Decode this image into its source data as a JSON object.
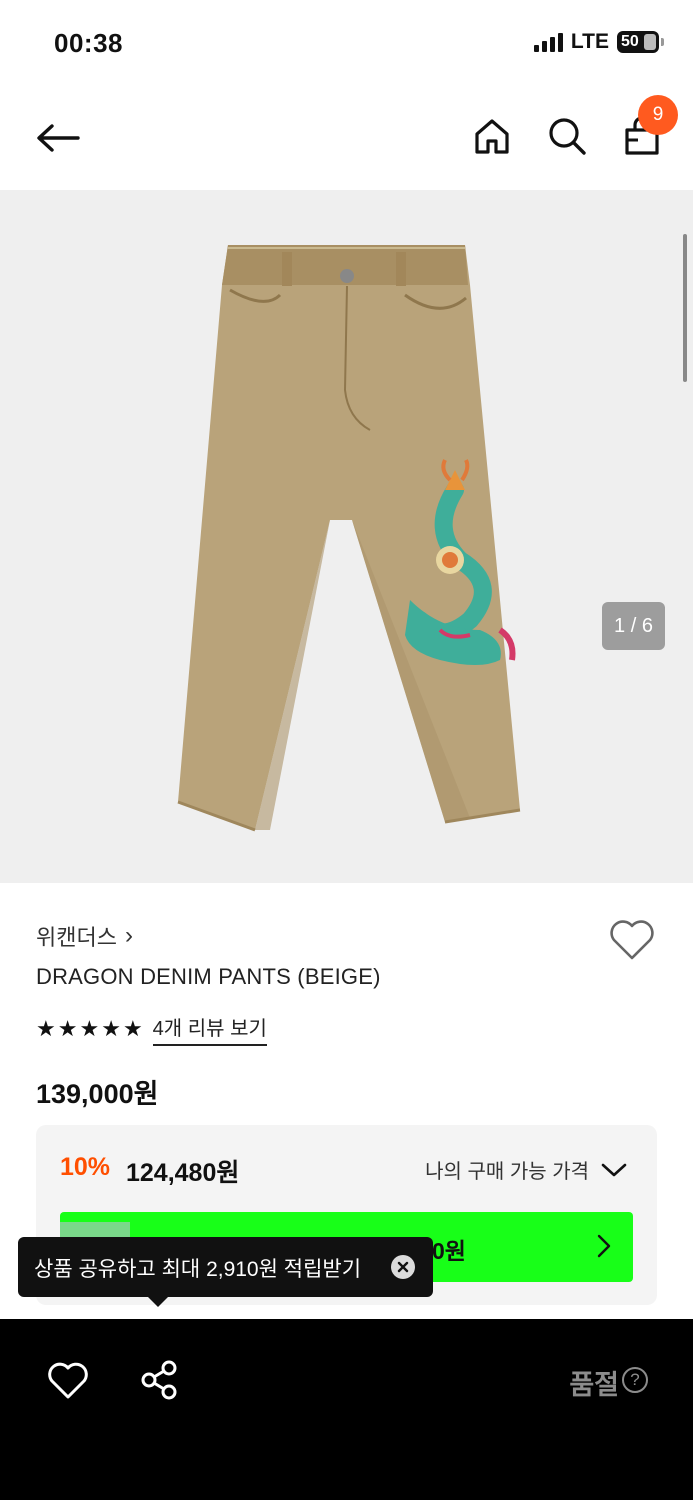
{
  "status_bar": {
    "time": "00:38",
    "network": "LTE",
    "battery": "50"
  },
  "nav": {
    "cart_count": "9",
    "icons": [
      "back-arrow-icon",
      "home-icon",
      "search-icon",
      "shopping-bag-icon"
    ]
  },
  "gallery": {
    "counter": "1 / 6"
  },
  "product": {
    "brand": "위캔더스",
    "brand_chevron": "›",
    "name": "DRAGON DENIM PANTS (BEIGE)",
    "rating_stars": 5,
    "review_link": "4개 리뷰 보기",
    "price": "139,000원"
  },
  "price_box": {
    "discount_rate": "10%",
    "discount_price": "124,480원",
    "my_price_label": "나의 구매 가능 가격",
    "promo_visible_text": "0원"
  },
  "tooltip": {
    "text": "상품 공유하고 최대 2,910원 적립받기"
  },
  "bottom_bar": {
    "status": "품절",
    "help": "?"
  },
  "colors": {
    "accent": "#ff5a1f",
    "discount": "#ff4f00",
    "promo_green": "#18ff18",
    "product_beige": "#b9a37a",
    "dragon_teal": "#3fae9a"
  }
}
